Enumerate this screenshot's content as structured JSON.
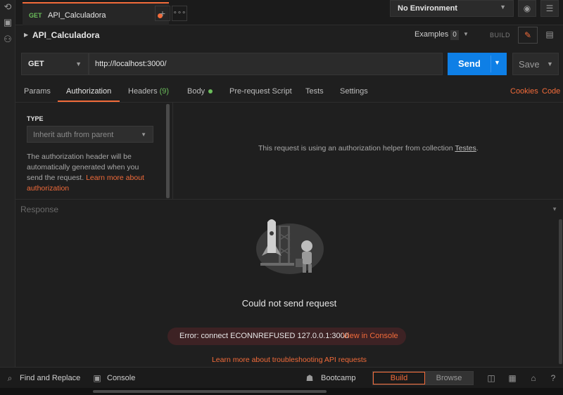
{
  "tab": {
    "method": "GET",
    "name": "API_Calculadora"
  },
  "environment": {
    "label": "No Environment"
  },
  "breadcrumb": {
    "title": "API_Calculadora",
    "examples_label": "Examples",
    "examples_count": "0",
    "build_label": "BUILD"
  },
  "request": {
    "method": "GET",
    "url": "http://localhost:3000/",
    "send_label": "Send",
    "save_label": "Save"
  },
  "request_tabs": {
    "params": "Params",
    "authorization": "Authorization",
    "headers": "Headers",
    "headers_count": "(9)",
    "body": "Body",
    "pre_request": "Pre-request Script",
    "tests": "Tests",
    "settings": "Settings",
    "cookies": "Cookies",
    "code": "Code"
  },
  "auth": {
    "type_label": "TYPE",
    "type_value": "Inherit auth from parent",
    "description": "The authorization header will be automatically generated when you send the request.",
    "learn_more": "Learn more about authorization",
    "helper_text": "This request is using an authorization helper from collection",
    "collection_link": "Testes",
    "helper_suffix": "."
  },
  "response": {
    "label": "Response",
    "error_title": "Could not send request",
    "error_message": "Error: connect ECONNREFUSED 127.0.0.1:3000",
    "view_console": "View in Console",
    "learn_more": "Learn more about troubleshooting API requests"
  },
  "statusbar": {
    "find_replace": "Find and Replace",
    "console": "Console",
    "bootcamp": "Bootcamp",
    "build": "Build",
    "browse": "Browse"
  },
  "colors": {
    "accent": "#f26b3a",
    "send_blue": "#0e7fe6",
    "get_green": "#6bbd5b"
  }
}
